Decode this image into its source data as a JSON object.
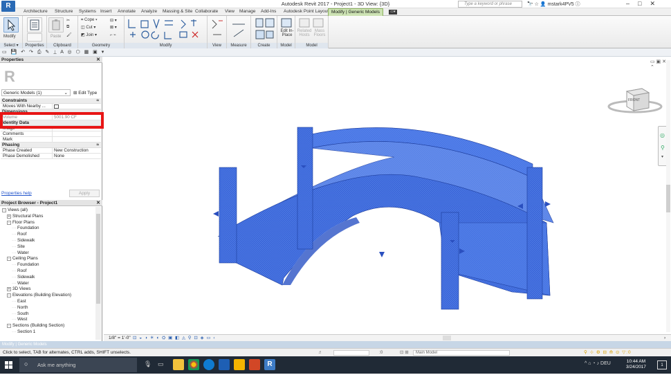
{
  "window": {
    "app_icon": "R",
    "title": "Autodesk Revit 2017 -   Project1 - 3D View: {3D}",
    "search_placeholder": "Type a keyword or phrase",
    "user": "mstark4PV5"
  },
  "tabs": [
    "Architecture",
    "Structure",
    "Systems",
    "Insert",
    "Annotate",
    "Analyze",
    "Massing & Site",
    "Collaborate",
    "View",
    "Manage",
    "Add-Ins",
    "Autodesk Point Layout",
    "Modify | Generic Models"
  ],
  "ribbon": {
    "select_label": "Select ▾",
    "properties_label": "Properties",
    "clipboard_label": "Clipboard",
    "geometry_label": "Geometry",
    "modify_label": "Modify",
    "view_label": "View",
    "measure_label": "Measure",
    "create_label": "Create",
    "model_label": "Model",
    "model2_label": "Model",
    "modify_btn": "Modify",
    "paste_btn": "Paste",
    "cope_btn": "Cope ▾",
    "cut_btn": "Cut ▾",
    "join_btn": "Join ▾",
    "edit_inplace": "Edit In-Place",
    "related_hosts": "Related Hosts",
    "mass_floors": "Mass Floors"
  },
  "properties": {
    "title": "Properties",
    "type_name": "Generic Models (1)",
    "edit_type": "Edit Type",
    "sections": {
      "constraints": "Constraints",
      "dimensions": "Dimensions",
      "identity": "Identity Data",
      "phasing": "Phasing"
    },
    "rows": {
      "moves_with": "Moves With Nearby ...",
      "volume_key": "Volume",
      "volume_val": "5001.90 CF",
      "image": "Image",
      "comments": "Comments",
      "mark": "Mark",
      "phase_created_key": "Phase Created",
      "phase_created_val": "New Construction",
      "phase_demolished_key": "Phase Demolished",
      "phase_demolished_val": "None"
    },
    "help_link": "Properties help",
    "apply": "Apply"
  },
  "browser": {
    "title": "Project Browser - Project1",
    "items": [
      {
        "label": "Views (all)",
        "level": 0,
        "tw": "-"
      },
      {
        "label": "Structural Plans",
        "level": 1,
        "tw": "+"
      },
      {
        "label": "Floor Plans",
        "level": 1,
        "tw": "-"
      },
      {
        "label": "Foundation",
        "level": 2
      },
      {
        "label": "Roof",
        "level": 2
      },
      {
        "label": "Sidewalk",
        "level": 2
      },
      {
        "label": "Site",
        "level": 2
      },
      {
        "label": "Water",
        "level": 2
      },
      {
        "label": "Ceiling Plans",
        "level": 1,
        "tw": "-"
      },
      {
        "label": "Foundation",
        "level": 2
      },
      {
        "label": "Roof",
        "level": 2
      },
      {
        "label": "Sidewalk",
        "level": 2
      },
      {
        "label": "Water",
        "level": 2
      },
      {
        "label": "3D Views",
        "level": 1,
        "tw": "+"
      },
      {
        "label": "Elevations (Building Elevation)",
        "level": 1,
        "tw": "-"
      },
      {
        "label": "East",
        "level": 2
      },
      {
        "label": "North",
        "level": 2
      },
      {
        "label": "South",
        "level": 2
      },
      {
        "label": "West",
        "level": 2
      },
      {
        "label": "Sections (Building Section)",
        "level": 1,
        "tw": "-"
      },
      {
        "label": "Section 1",
        "level": 2
      }
    ]
  },
  "viewcube": {
    "face": "FRONT"
  },
  "view_control": {
    "scale": "1/8\" = 1'-0\""
  },
  "modify_bar": "Modify | Generic Models",
  "status": {
    "hint": "Click to select, TAB for alternates, CTRL adds, SHIFT unselects.",
    "coord": ":0",
    "model": "Main Model"
  },
  "taskbar": {
    "search": "Ask me anything",
    "lang": "DEU",
    "time": "10:44 AM",
    "date": "3/24/2017",
    "notif": "1"
  },
  "colors": {
    "accent": "#2a6ab5",
    "model_blue": "#3c6fe0",
    "highlight": "#e81515"
  }
}
